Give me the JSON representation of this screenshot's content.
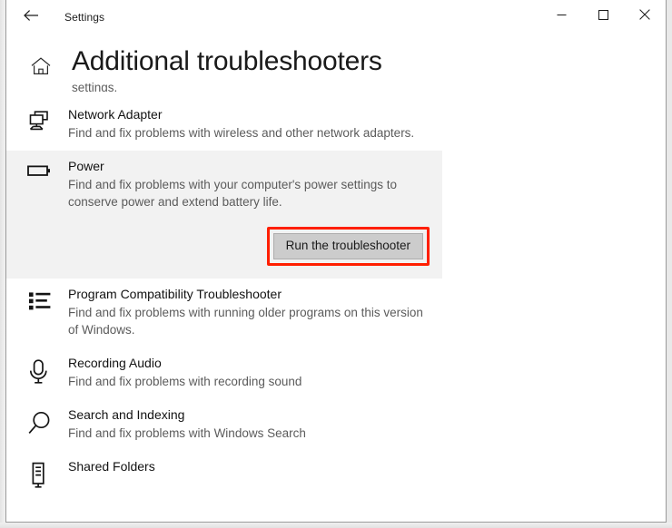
{
  "window": {
    "app_title": "Settings",
    "back_icon": "back-arrow-icon",
    "minimize_label": "minimize-icon",
    "maximize_label": "maximize-icon",
    "close_label": "close-icon"
  },
  "header": {
    "home_icon": "home-icon",
    "title": "Additional troubleshooters",
    "clipped_text": "settings."
  },
  "troubleshooters": [
    {
      "icon": "network-adapter-icon",
      "title": "Network Adapter",
      "desc": "Find and fix problems with wireless and other network adapters.",
      "selected": false
    },
    {
      "icon": "battery-power-icon",
      "title": "Power",
      "desc": "Find and fix problems with your computer's power settings to conserve power and extend battery life.",
      "selected": true,
      "button_label": "Run the troubleshooter"
    },
    {
      "icon": "list-icon",
      "title": "Program Compatibility Troubleshooter",
      "desc": "Find and fix problems with running older programs on this version of Windows.",
      "selected": false
    },
    {
      "icon": "microphone-icon",
      "title": "Recording Audio",
      "desc": "Find and fix problems with recording sound",
      "selected": false
    },
    {
      "icon": "search-icon",
      "title": "Search and Indexing",
      "desc": "Find and fix problems with Windows Search",
      "selected": false
    },
    {
      "icon": "shared-folders-icon",
      "title": "Shared Folders",
      "desc": "",
      "selected": false
    }
  ],
  "colors": {
    "selection_bg": "#f2f2f2",
    "annotation_red": "#ff1f00",
    "button_bg": "#cccccc"
  }
}
